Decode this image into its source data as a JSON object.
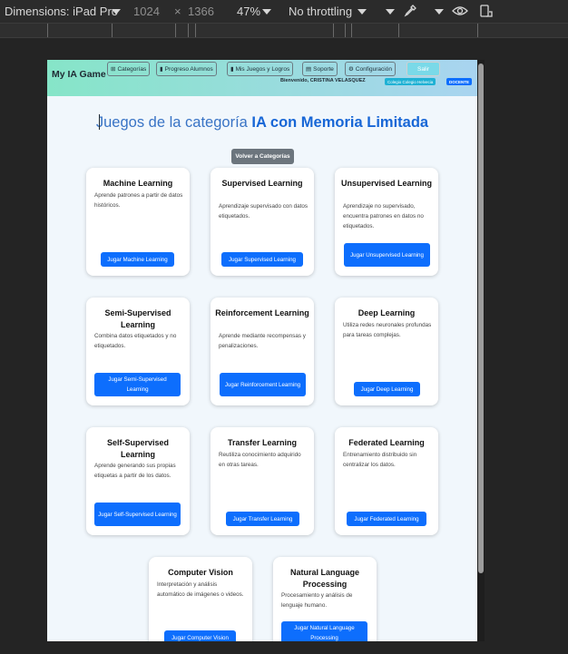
{
  "devtools": {
    "dimensions_label": "Dimensions: iPad Pro",
    "width": "1024",
    "times": "×",
    "height": "1366",
    "zoom": "47%",
    "throttling": "No throttling"
  },
  "nav": {
    "brand": "My IA Game",
    "items": [
      {
        "label": "Categorías",
        "icon": "grid-icon",
        "glyph": "⊞"
      },
      {
        "label": "Progreso Alumnos",
        "icon": "bar-chart-icon",
        "glyph": "▮"
      },
      {
        "label": "Mis Juegos y Logros",
        "icon": "bar-chart-icon",
        "glyph": "▮"
      },
      {
        "label": "Soporte",
        "icon": "support-icon",
        "glyph": "▤"
      },
      {
        "label": "Configuración",
        "icon": "gear-icon",
        "glyph": "⚙"
      }
    ],
    "logout": "Salir",
    "welcome": "Bienvenido, CRISTINA VELASQUEZ",
    "school_badge": "Colegio Colegio Helvecia",
    "role_badge": "DOCENTE"
  },
  "page": {
    "title_prefix": "Juegos de la categoría",
    "title_category": "IA con Memoria Limitada",
    "back_button": "Volver a Categorías"
  },
  "cards": [
    {
      "title": "Machine Learning",
      "desc": "Aprende patrones a partir de datos históricos.",
      "button": "Jugar Machine Learning"
    },
    {
      "title": "Supervised Learning",
      "desc": "Aprendizaje supervisado con datos etiquetados.",
      "button": "Jugar Supervised Learning"
    },
    {
      "title": "Unsupervised Learning",
      "desc": "Aprendizaje no supervisado, encuentra patrones en datos no etiquetados.",
      "button": "Jugar Unsupervised Learning"
    },
    {
      "title": "Semi-Supervised Learning",
      "desc": "Combina datos etiquetados y no etiquetados.",
      "button": "Jugar Semi-Supervised Learning"
    },
    {
      "title": "Reinforcement Learning",
      "desc": "Aprende mediante recompensas y penalizaciones.",
      "button": "Jugar Reinforcement Learning"
    },
    {
      "title": "Deep Learning",
      "desc": "Utiliza redes neuronales profundas para tareas complejas.",
      "button": "Jugar Deep Learning"
    },
    {
      "title": "Self-Supervised Learning",
      "desc": "Aprende generando sus propias etiquetas a partir de los datos.",
      "button": "Jugar Self-Supervised Learning"
    },
    {
      "title": "Transfer Learning",
      "desc": "Reutiliza conocimiento adquirido en otras tareas.",
      "button": "Jugar Transfer Learning"
    },
    {
      "title": "Federated Learning",
      "desc": "Entrenamiento distribuido sin centralizar los datos.",
      "button": "Jugar Federated Learning"
    },
    {
      "title": "Computer Vision",
      "desc": "Interpretación y análisis automático de imágenes o videos.",
      "button": "Jugar Computer Vision"
    },
    {
      "title": "Natural Language Processing",
      "desc": "Procesamiento y análisis de lenguaje humano.",
      "button": "Jugar Natural Language Processing"
    }
  ],
  "colors": {
    "primary": "#0d6efd",
    "secondary": "#6c757d",
    "heading": "#1766d6",
    "nav_gradient_start": "#86e5c8",
    "nav_gradient_end": "#a9d4f0"
  }
}
